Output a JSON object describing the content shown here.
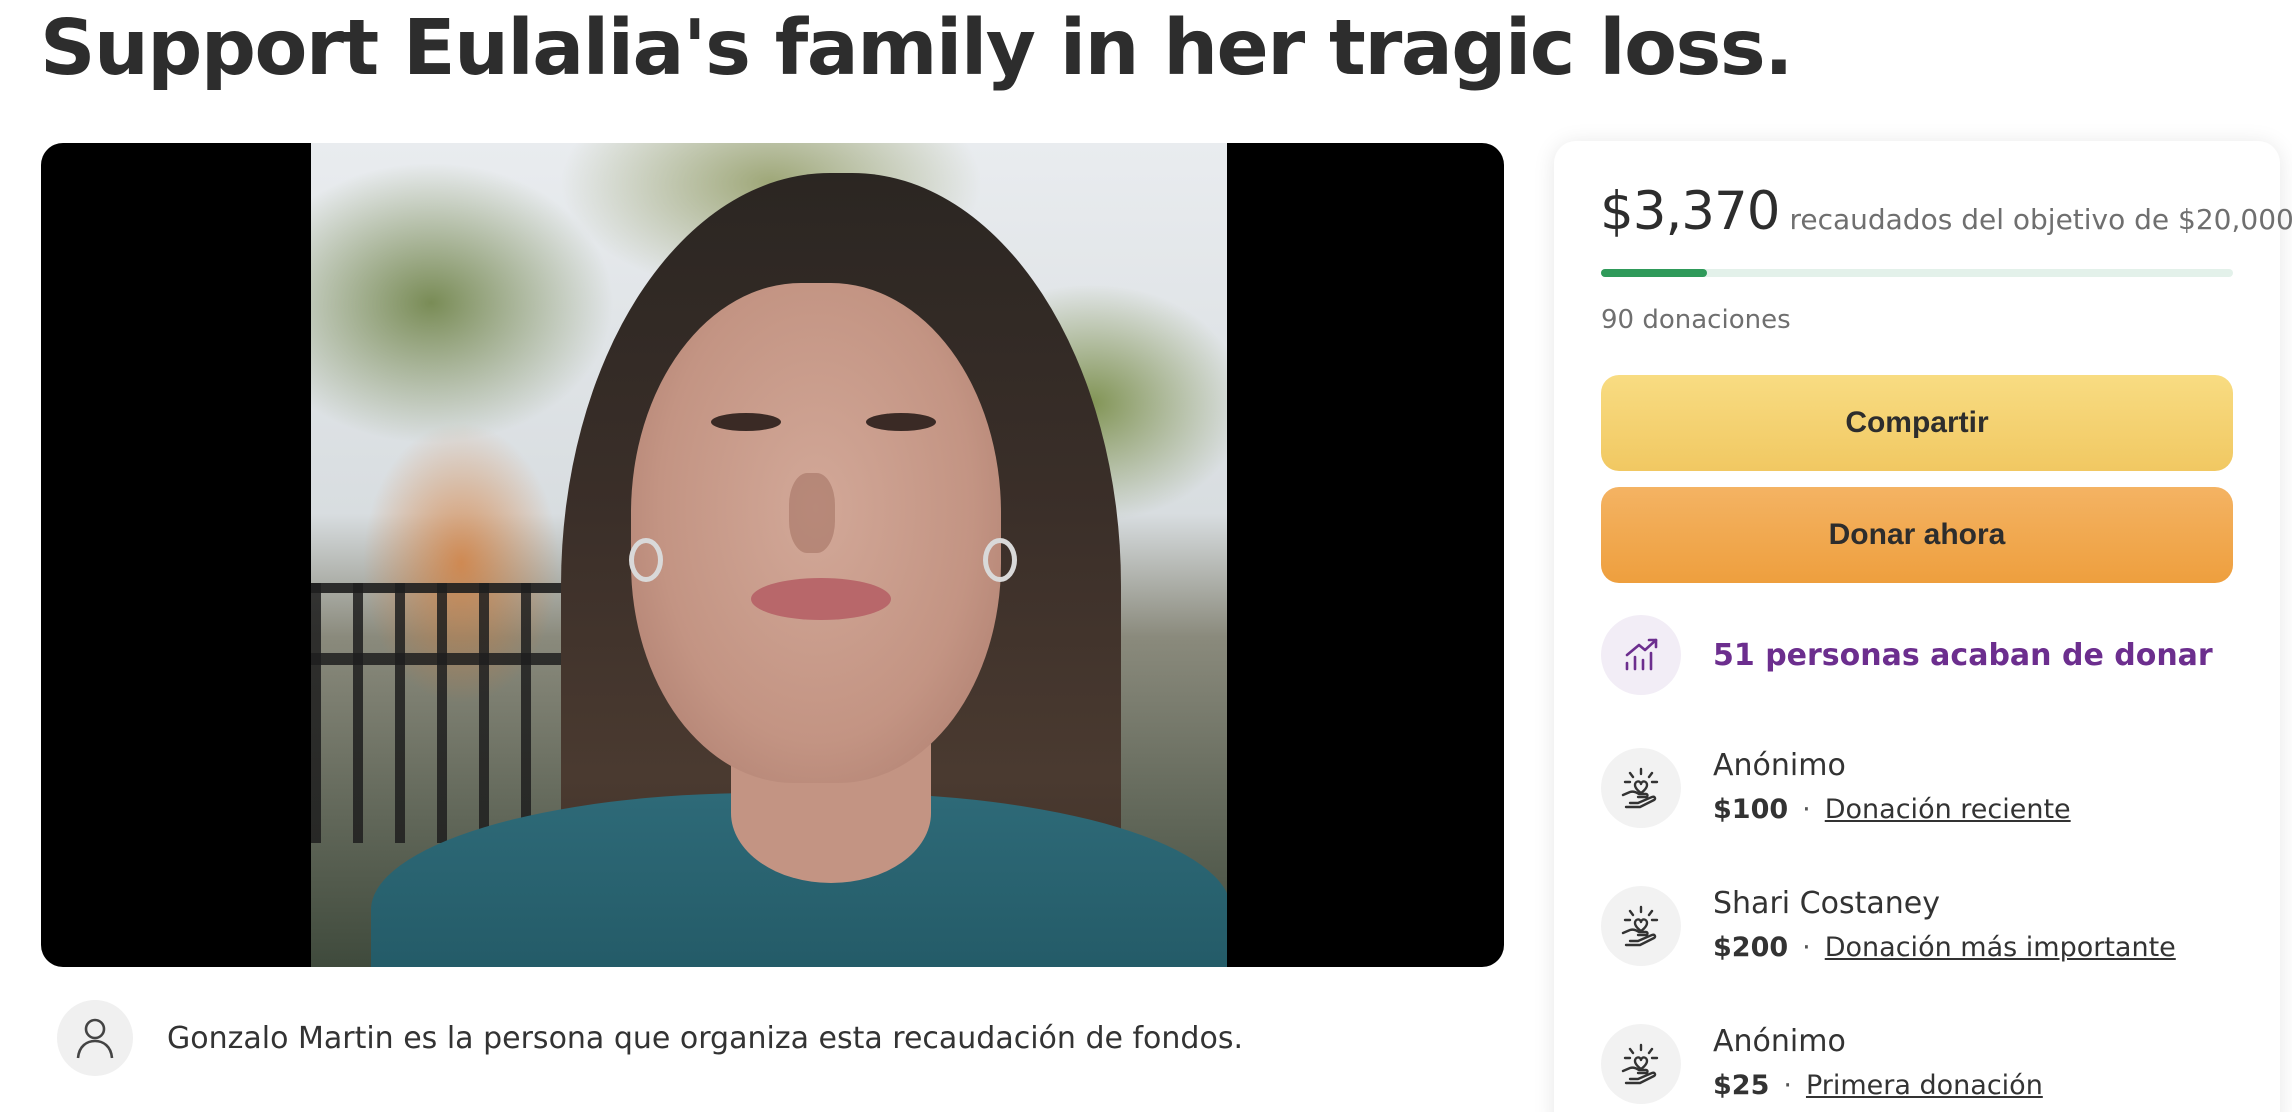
{
  "page_title": "Support Eulalia's family in her tragic loss.",
  "organizer": {
    "text": "Gonzalo Martin es la persona que organiza esta recaudación de fondos."
  },
  "stats": {
    "raised": "$3,370",
    "goal_text": "recaudados del objetivo de $20,000",
    "progress_fraction": 0.1685,
    "donations": "90 donaciones"
  },
  "buttons": {
    "share": "Compartir",
    "donate": "Donar ahora"
  },
  "trend": {
    "text": "51 personas acaban de donar",
    "icon": "trending-up-icon"
  },
  "donors": [
    {
      "name": "Anónimo",
      "amount": "$100",
      "tag": "Donación reciente",
      "icon": "heart-hand-icon"
    },
    {
      "name": "Shari Costaney",
      "amount": "$200",
      "tag": "Donación más importante",
      "icon": "heart-hand-icon"
    },
    {
      "name": "Anónimo",
      "amount": "$25",
      "tag": "Primera donación",
      "icon": "heart-hand-icon"
    }
  ],
  "colors": {
    "progress": "#2f9a5a",
    "share_button": "#f4d270",
    "donate_button": "#f0a848",
    "trend_text": "#6c2e8e"
  }
}
